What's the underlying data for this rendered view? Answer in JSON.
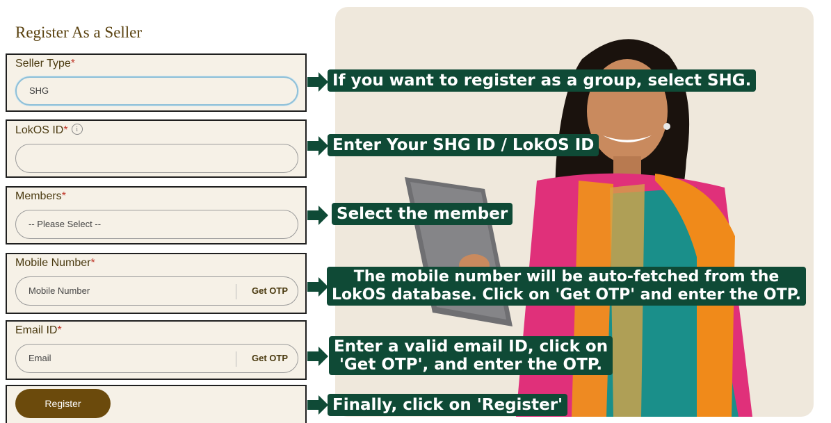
{
  "form": {
    "title": "Register As a Seller",
    "required_mark": "*",
    "info_glyph": "i",
    "seller_type": {
      "label": "Seller Type",
      "value": "SHG"
    },
    "lokos_id": {
      "label": "LokOS ID",
      "value": ""
    },
    "members": {
      "label": "Members",
      "value": "-- Please Select --"
    },
    "mobile": {
      "label": "Mobile Number",
      "placeholder": "Mobile Number",
      "otp_label": "Get OTP"
    },
    "email": {
      "label": "Email ID",
      "placeholder": "Email",
      "otp_label": "Get OTP"
    },
    "register_label": "Register"
  },
  "callouts": {
    "seller_type": "If you want to register as a group, select SHG.",
    "lokos_id": "Enter Your SHG ID / LokOS ID",
    "members": "Select the member",
    "mobile_line1": "The mobile number will be auto-fetched from the",
    "mobile_line2": "LokOS database. Click on 'Get OTP' and enter the OTP.",
    "email_line1": "Enter a valid email ID, click on",
    "email_line2": "'Get OTP', and enter the OTP.",
    "register": "Finally, click on 'Register'"
  },
  "colors": {
    "callout_bg": "#0f4a36",
    "brand_brown": "#6b4a0c",
    "field_bg": "#f6f1e7"
  },
  "icons": {
    "arrow": "right-arrow-icon",
    "info": "info-icon",
    "illustration": "woman-with-laptop-illustration"
  }
}
